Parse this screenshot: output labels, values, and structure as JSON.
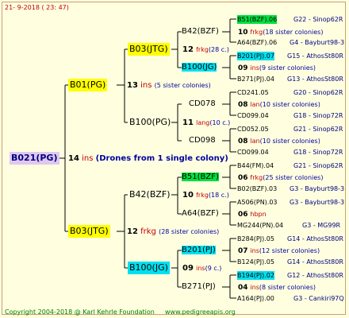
{
  "header": {
    "date": "21-  9-2018 (  23:  47)"
  },
  "footer": {
    "copyright": "Copyright 2004-2018 @ Karl Kehrle Foundation",
    "site": "www.pedigreeapis.org"
  },
  "root": {
    "label": "B021(PG)",
    "num": "14",
    "suffix": "ins",
    "note": "(Drones from 1 single colony)"
  },
  "gen1": [
    {
      "label": "B01(PG)",
      "num": "13",
      "suffix": "ins",
      "note": "(5 sister colonies)"
    },
    {
      "label": "B03(JTG)",
      "num": "12",
      "suffix": "frkg",
      "note": "(28 sister colonies)"
    }
  ],
  "gen2": [
    {
      "label": "B03(JTG)",
      "num": "12",
      "suffix": "frkg",
      "note": "(28 c.)"
    },
    {
      "label": "B100(PG)",
      "num": "11",
      "suffix": "lang",
      "note": "(10 c.)"
    },
    {
      "label": "B42(BZF)",
      "num": "10",
      "suffix": "frkg",
      "note": "(18 c.)"
    },
    {
      "label": "B100(JG)",
      "num": "09",
      "suffix": "ins",
      "note": "(9 c.)"
    }
  ],
  "gen3": [
    {
      "label": "B42(BZF)",
      "num": "10",
      "suffix": "frkg",
      "note": "(18 sister colonies)"
    },
    {
      "label": "B100(JG)",
      "num": "09",
      "suffix": "ins",
      "note": "(9 sister colonies)"
    },
    {
      "label": "CD078",
      "num": "08",
      "suffix": "lan",
      "note": "(10 sister colonies)"
    },
    {
      "label": "CD098",
      "num": "08",
      "suffix": "lan",
      "note": "(10 sister colonies)"
    },
    {
      "label": "B51(BZF)",
      "num": "06",
      "suffix": "frkg",
      "note": "(25 sister colonies)"
    },
    {
      "label": "A64(BZF)",
      "num": "06",
      "suffix": "hbpn",
      "note": ""
    },
    {
      "label": "B201(PJ)",
      "num": "07",
      "suffix": "ins",
      "note": "(12 sister colonies)"
    },
    {
      "label": "B271(PJ)",
      "num": "04",
      "suffix": "ins",
      "note": "(8 sister colonies)"
    }
  ],
  "gen4": [
    {
      "label": "B51(BZF).06",
      "info": "G22 - Sinop62R"
    },
    {
      "label": "A64(BZF).06",
      "info": "G4 - Bayburt98-3"
    },
    {
      "label": "B201(PJ).07",
      "info": "G15 - AthosSt80R"
    },
    {
      "label": "B271(PJ).04",
      "info": "G13 - AthosSt80R"
    },
    {
      "label": "CD241.05",
      "info": "G20 - Sinop62R"
    },
    {
      "label": "CD099.04",
      "info": "G18 - Sinop72R"
    },
    {
      "label": "CD052.05",
      "info": "G21 - Sinop62R"
    },
    {
      "label": "CD099.04",
      "info": "G18 - Sinop72R"
    },
    {
      "label": "B44(FM).04",
      "info": "G21 - Sinop62R"
    },
    {
      "label": "B02(BZF).03",
      "info": "G3 - Bayburt98-3"
    },
    {
      "label": "A506(PN).03",
      "info": "G3 - Bayburt98-3"
    },
    {
      "label": "MG244(PN).04",
      "info": "G3 - MG99R"
    },
    {
      "label": "B284(PJ).05",
      "info": "G14 - AthosSt80R"
    },
    {
      "label": "B124(PJ).05",
      "info": "G14 - AthosSt80R"
    },
    {
      "label": "B194(PJ).02",
      "info": "G12 - AthosSt80R"
    },
    {
      "label": "A164(PJ).00",
      "info": "G3 - Cankiri97Q"
    }
  ],
  "colors": {
    "highlight_yellow": "#ffff00",
    "highlight_green": "#00e040",
    "highlight_cyan": "#00e0f0",
    "root_bg": "#e0c8f0",
    "count_red": "#c00000",
    "info_blue": "#000080"
  }
}
